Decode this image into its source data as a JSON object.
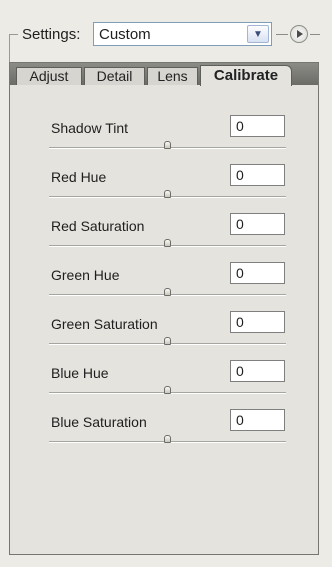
{
  "settings": {
    "label": "Settings:",
    "value": "Custom"
  },
  "tabs": [
    {
      "label": "Adjust",
      "active": false
    },
    {
      "label": "Detail",
      "active": false
    },
    {
      "label": "Lens",
      "active": false
    },
    {
      "label": "Calibrate",
      "active": true
    }
  ],
  "controls": [
    {
      "label": "Shadow Tint",
      "value": "0",
      "slider": 0.5
    },
    {
      "label": "Red Hue",
      "value": "0",
      "slider": 0.5
    },
    {
      "label": "Red Saturation",
      "value": "0",
      "slider": 0.5
    },
    {
      "label": "Green Hue",
      "value": "0",
      "slider": 0.5
    },
    {
      "label": "Green Saturation",
      "value": "0",
      "slider": 0.5
    },
    {
      "label": "Blue Hue",
      "value": "0",
      "slider": 0.5
    },
    {
      "label": "Blue Saturation",
      "value": "0",
      "slider": 0.5
    }
  ],
  "icons": {
    "dropdown": "chevron-down-icon",
    "menu": "play-circle-icon"
  }
}
